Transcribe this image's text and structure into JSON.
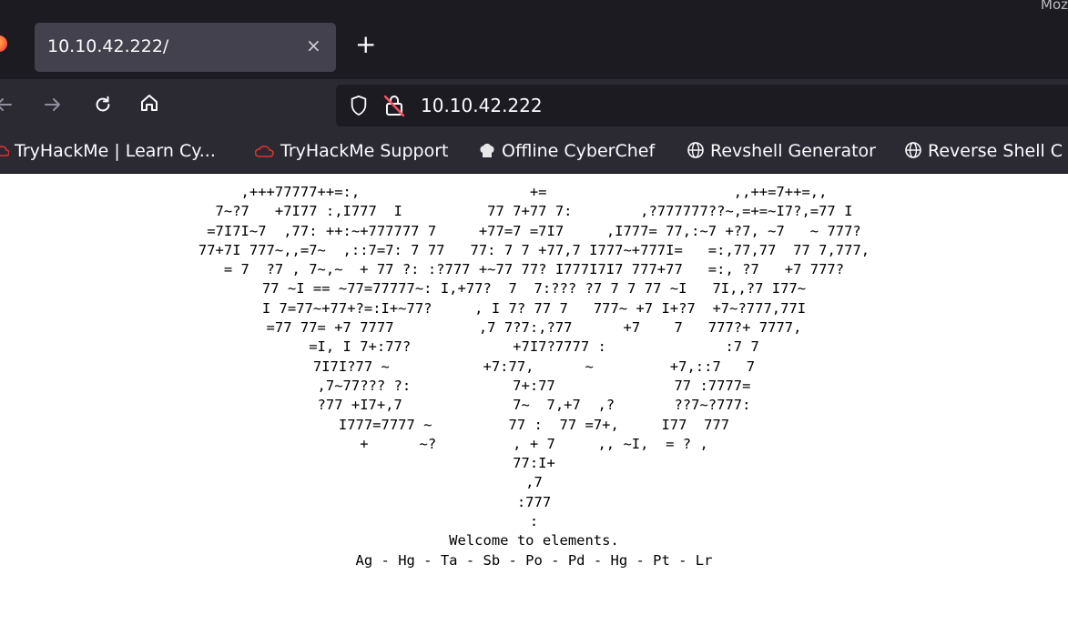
{
  "window": {
    "title_fragment": "Moz"
  },
  "tab": {
    "title": "10.10.42.222/",
    "close_symbol": "×",
    "new_tab_symbol": "+"
  },
  "nav": {
    "back_icon": "back-arrow-icon",
    "forward_icon": "forward-arrow-icon",
    "reload_icon": "reload-icon",
    "home_icon": "home-icon",
    "url": "10.10.42.222"
  },
  "bookmarks": [
    {
      "label": "TryHackMe | Learn Cy...",
      "icon": "tryhackme-icon"
    },
    {
      "label": "TryHackMe Support",
      "icon": "tryhackme-icon"
    },
    {
      "label": "Offline CyberChef",
      "icon": "chef-hat-icon"
    },
    {
      "label": "Revshell Generator",
      "icon": "globe-icon"
    },
    {
      "label": "Reverse Shell C",
      "icon": "globe-icon"
    }
  ],
  "page": {
    "art_lines": [
      ",+++77777++=:,                    +=                      ,,++=7++=,,",
      "7~?7   +7I77 :,I777  I          77 7+77 7:        ,?777777??~,=+=~I7?,=77 I",
      "=7I7I~7  ,77: ++:~+777777 7     +77=7 =7I7     ,I777= 77,:~7 +?7, ~7   ~ 777?",
      "77+7I 777~,,=7~  ,::7=7: 7 77   77: 7 7 +77,7 I777~+777I=   =:,77,77  77 7,777,",
      "= 7  ?7 , 7~,~  + 77 ?: :?777 +~77 77? I777I7I7 777+77   =:, ?7   +7 777?",
      "77 ~I == ~77=77777~: I,+77?  7  7:??? ?7 7 7 77 ~I   7I,,?7 I77~",
      "I 7=77~+77+?=:I+~77?     , I 7? 77 7   777~ +7 I+?7  +7~?777,77I",
      "=77 77= +7 7777          ,7 7?7:,?77      +7    7   777?+ 7777,",
      "=I, I 7+:77?            +7I7?7777 :              :7 7",
      "7I7I?77 ~           +7:77,      ~         +7,::7   7",
      ",7~77??? ?:            7+:77              77 :7777=",
      "?77 +I7+,7             7~  7,+7  ,?       ??7~?777:",
      "I777=7777 ~         77 :  77 =7+,     I77  777",
      "+      ~?         , + 7     ,, ~I,  = ? ,",
      "77:I+",
      ",7",
      ":777",
      ":",
      "Welcome to elements.",
      "Ag - Hg - Ta - Sb - Po - Pd - Hg - Pt - Lr"
    ]
  }
}
